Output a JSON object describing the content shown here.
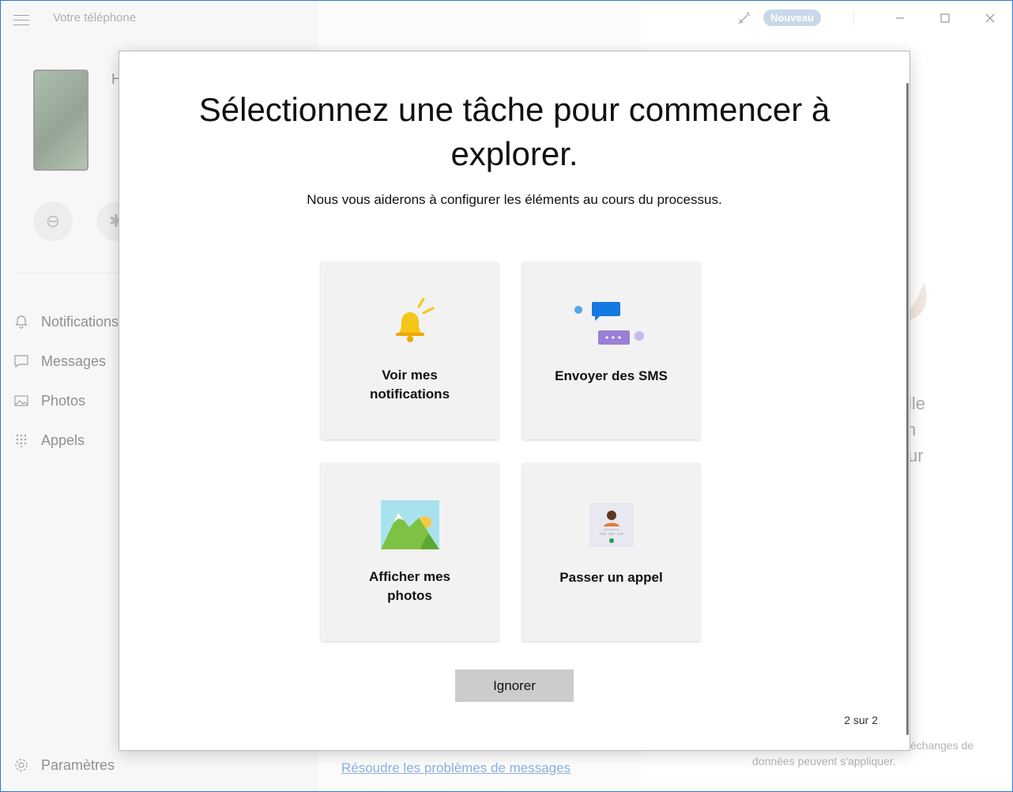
{
  "window": {
    "app_title": "Votre téléphone",
    "new_badge": "Nouveau"
  },
  "sidebar": {
    "phone_name": "H",
    "items": [
      {
        "label": "Notifications",
        "icon": "bell-icon"
      },
      {
        "label": "Messages",
        "icon": "message-icon"
      },
      {
        "label": "Photos",
        "icon": "photo-icon"
      },
      {
        "label": "Appels",
        "icon": "dialpad-icon"
      }
    ],
    "settings_label": "Paramètres"
  },
  "main": {
    "fix_link": "Résoudre les problèmes de messages",
    "right_fragments": [
      "lle",
      "n",
      "ur"
    ],
    "footer_line1": "échanges de",
    "footer_line2": "données peuvent s'appliquer."
  },
  "dialog": {
    "title": "Sélectionnez une tâche pour commencer à explorer.",
    "subtitle": "Nous vous aiderons à configurer les éléments au cours du processus.",
    "cards": [
      {
        "label_line1": "Voir mes",
        "label_line2": "notifications",
        "icon": "bell-icon"
      },
      {
        "label_line1": "Envoyer des SMS",
        "icon": "chat-bubbles-icon"
      },
      {
        "label_line1": "Afficher mes",
        "label_line2": "photos",
        "icon": "landscape-photo-icon"
      },
      {
        "label_line1": "Passer un appel",
        "icon": "contact-call-icon"
      }
    ],
    "ignore_button": "Ignorer",
    "pager": "2 sur 2"
  },
  "colors": {
    "accent_link": "#2b6fc2",
    "badge": "#9ab8d6",
    "card_bg": "#f2f2f2",
    "button_bg": "#cccccc"
  }
}
